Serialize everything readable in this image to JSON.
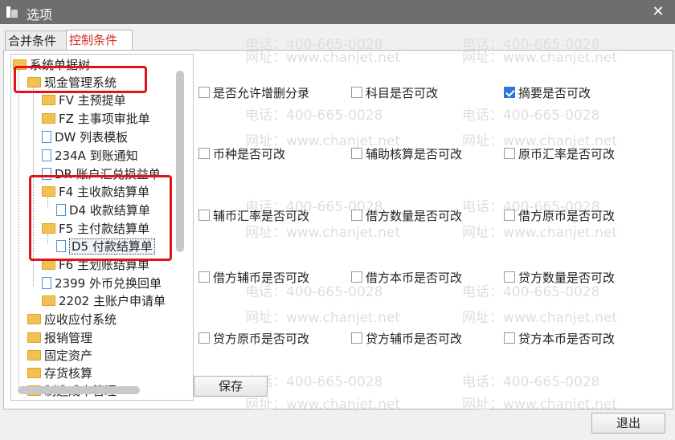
{
  "window": {
    "title": "选项",
    "close_glyph": "✕"
  },
  "tabs": [
    {
      "label": "合并条件",
      "active": false
    },
    {
      "label": "控制条件",
      "active": true
    }
  ],
  "tree": {
    "root": "系统单据树",
    "items": [
      {
        "label": "现金管理系统",
        "icon": "folder-icon"
      },
      {
        "label": "FV 主预提单",
        "icon": "folder-icon"
      },
      {
        "label": "FZ 主事项审批单",
        "icon": "folder-icon"
      },
      {
        "label": "DW 列表模板",
        "icon": "document-icon"
      },
      {
        "label": "234A 到账通知",
        "icon": "document-icon"
      },
      {
        "label": "DR 账户汇兑损益单",
        "icon": "document-icon"
      },
      {
        "label": "F4 主收款结算单",
        "icon": "folder-icon"
      },
      {
        "label": "D4 收款结算单",
        "icon": "document-icon"
      },
      {
        "label": "F5 主付款结算单",
        "icon": "folder-icon"
      },
      {
        "label": "D5 付款结算单",
        "icon": "document-icon",
        "selected": true
      },
      {
        "label": "F6 主划账结算单",
        "icon": "folder-icon"
      },
      {
        "label": "2399 外币兑换回单",
        "icon": "document-icon"
      },
      {
        "label": "2202 主账户申请单",
        "icon": "folder-icon"
      },
      {
        "label": "应收应付系统",
        "icon": "folder-icon"
      },
      {
        "label": "报销管理",
        "icon": "folder-icon"
      },
      {
        "label": "固定资产",
        "icon": "folder-icon"
      },
      {
        "label": "存货核算",
        "icon": "folder-icon"
      },
      {
        "label": "制造成本管理",
        "icon": "folder-icon"
      }
    ]
  },
  "options": [
    {
      "label": "是否允许增删分录",
      "checked": false
    },
    {
      "label": "科目是否可改",
      "checked": false
    },
    {
      "label": "摘要是否可改",
      "checked": true
    },
    {
      "label": "币种是否可改",
      "checked": false
    },
    {
      "label": "辅助核算是否可改",
      "checked": false
    },
    {
      "label": "原币汇率是否可改",
      "checked": false
    },
    {
      "label": "辅币汇率是否可改",
      "checked": false
    },
    {
      "label": "借方数量是否可改",
      "checked": false
    },
    {
      "label": "借方原币是否可改",
      "checked": false
    },
    {
      "label": "借方辅币是否可改",
      "checked": false
    },
    {
      "label": "借方本币是否可改",
      "checked": false
    },
    {
      "label": "贷方数量是否可改",
      "checked": false
    },
    {
      "label": "贷方原币是否可改",
      "checked": false
    },
    {
      "label": "贷方辅币是否可改",
      "checked": false
    },
    {
      "label": "贷方本币是否可改",
      "checked": false
    }
  ],
  "buttons": {
    "save": "保存",
    "exit": "退出"
  },
  "watermark": {
    "phone": "电话：400-665-0028",
    "site": "网址：www.chanjet.net"
  }
}
